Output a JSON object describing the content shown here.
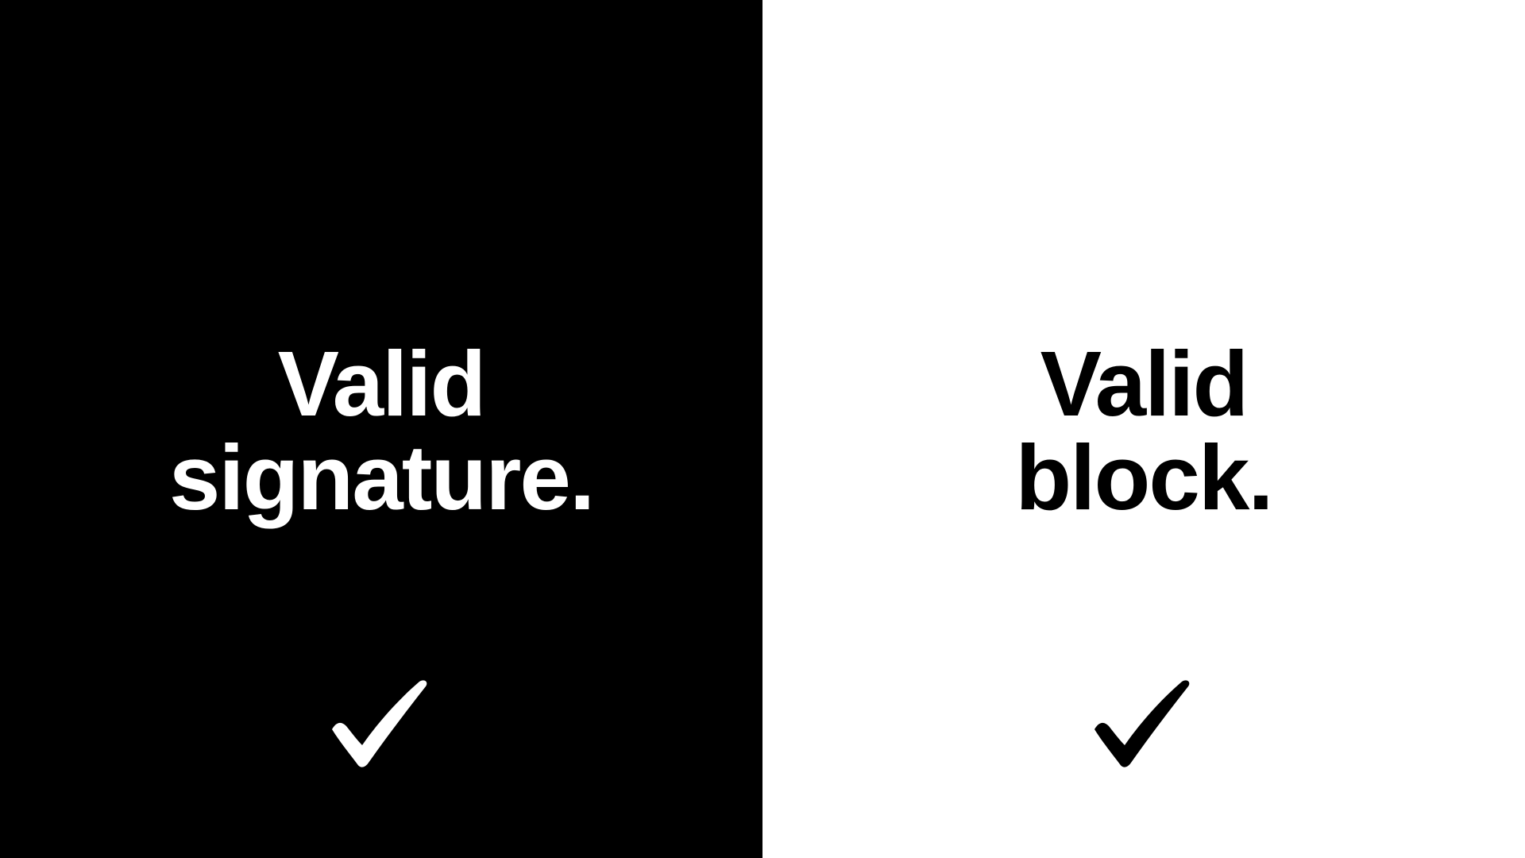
{
  "left_panel": {
    "background": "#000000",
    "text_color": "#ffffff",
    "headline_line1": "Valid",
    "headline_line2": "signature.",
    "icon": "checkmark-icon"
  },
  "right_panel": {
    "background": "#ffffff",
    "text_color": "#000000",
    "headline_line1": "Valid",
    "headline_line2": "block.",
    "icon": "checkmark-icon"
  }
}
